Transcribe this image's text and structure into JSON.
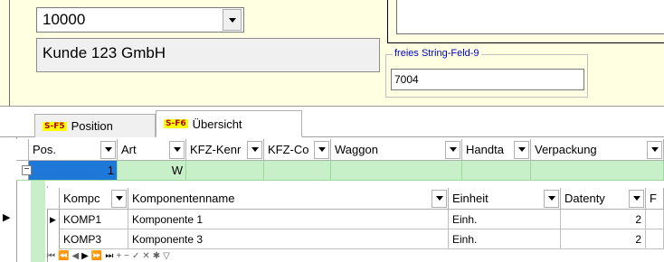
{
  "header": {
    "customer_number": "10000",
    "customer_name": "Kunde 123 GmbH",
    "string_field_label": "freies String-Feld-9",
    "string_field_value": "7004"
  },
  "tabs": [
    {
      "key": "S-F5",
      "label": "Position"
    },
    {
      "key": "S-F6",
      "label": "Übersicht"
    }
  ],
  "grid": {
    "columns": [
      "Pos.",
      "Art",
      "KFZ-Kenr",
      "KFZ-Co",
      "Waggon",
      "Handta",
      "Verpackung"
    ],
    "row": {
      "pos": "1",
      "art": "W"
    }
  },
  "subgrid": {
    "columns": [
      "Kompc",
      "Komponentenname",
      "Einheit",
      "Datenty",
      "F"
    ],
    "rows": [
      {
        "code": "KOMP1",
        "name": "Komponente 1",
        "unit": "Einh.",
        "type": "2"
      },
      {
        "code": "KOMP3",
        "name": "Komponente 3",
        "unit": "Einh.",
        "type": "2"
      }
    ]
  },
  "icons": {
    "row_pointer": "current-row-arrow-icon",
    "collapse": "minus-icon",
    "dropdown": "chevron-down-icon"
  }
}
